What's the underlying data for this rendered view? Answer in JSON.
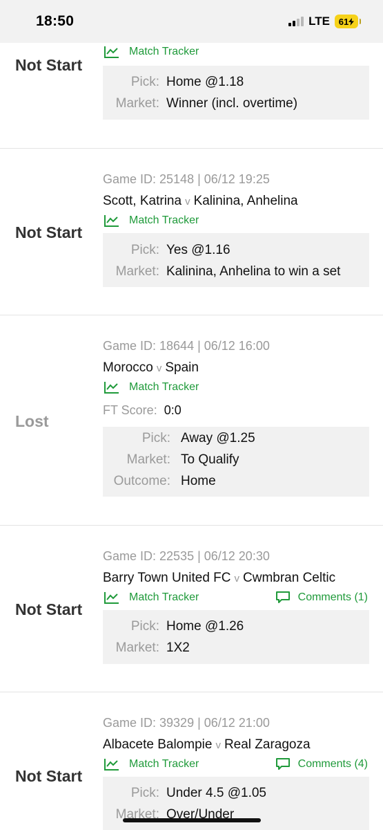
{
  "status_bar": {
    "time": "18:50",
    "network": "LTE",
    "battery": "61"
  },
  "cards": [
    {
      "status": "Not Start",
      "tracker_label": "Match Tracker",
      "pick_label": "Pick:",
      "pick": "Home @1.18",
      "market_label": "Market:",
      "market": "Winner (incl. overtime)"
    },
    {
      "status": "Not Start",
      "game_id": "Game ID: 25148 | 06/12 19:25",
      "home": "Scott, Katrina",
      "vs": "v",
      "away": "Kalinina, Anhelina",
      "tracker_label": "Match Tracker",
      "pick_label": "Pick:",
      "pick": "Yes @1.16",
      "market_label": "Market:",
      "market": "Kalinina, Anhelina to win a set"
    },
    {
      "status": "Lost",
      "game_id": "Game ID: 18644 | 06/12 16:00",
      "home": "Morocco",
      "vs": "v",
      "away": "Spain",
      "tracker_label": "Match Tracker",
      "ft_label": "FT Score:",
      "ft_score": "0:0",
      "pick_label": "Pick:",
      "pick": "Away @1.25",
      "market_label": "Market:",
      "market": "To Qualify",
      "outcome_label": "Outcome:",
      "outcome": "Home"
    },
    {
      "status": "Not Start",
      "game_id": "Game ID: 22535 | 06/12 20:30",
      "home": "Barry Town United FC",
      "vs": "v",
      "away": "Cwmbran Celtic",
      "tracker_label": "Match Tracker",
      "comments_label": "Comments (1)",
      "pick_label": "Pick:",
      "pick": "Home @1.26",
      "market_label": "Market:",
      "market": "1X2"
    },
    {
      "status": "Not Start",
      "game_id": "Game ID: 39329 | 06/12 21:00",
      "home": "Albacete Balompie",
      "vs": "v",
      "away": "Real Zaragoza",
      "tracker_label": "Match Tracker",
      "comments_label": "Comments (4)",
      "pick_label": "Pick:",
      "pick": "Under 4.5 @1.05",
      "market_label": "Market:",
      "market": "Over/Under"
    }
  ],
  "colors": {
    "accent_green": "#1f9a3a",
    "muted_gray": "#9a9a9a",
    "battery_yellow": "#f6d21a"
  },
  "icons": {
    "tracker": "line-chart-icon",
    "comments": "speech-bubble-icon"
  }
}
